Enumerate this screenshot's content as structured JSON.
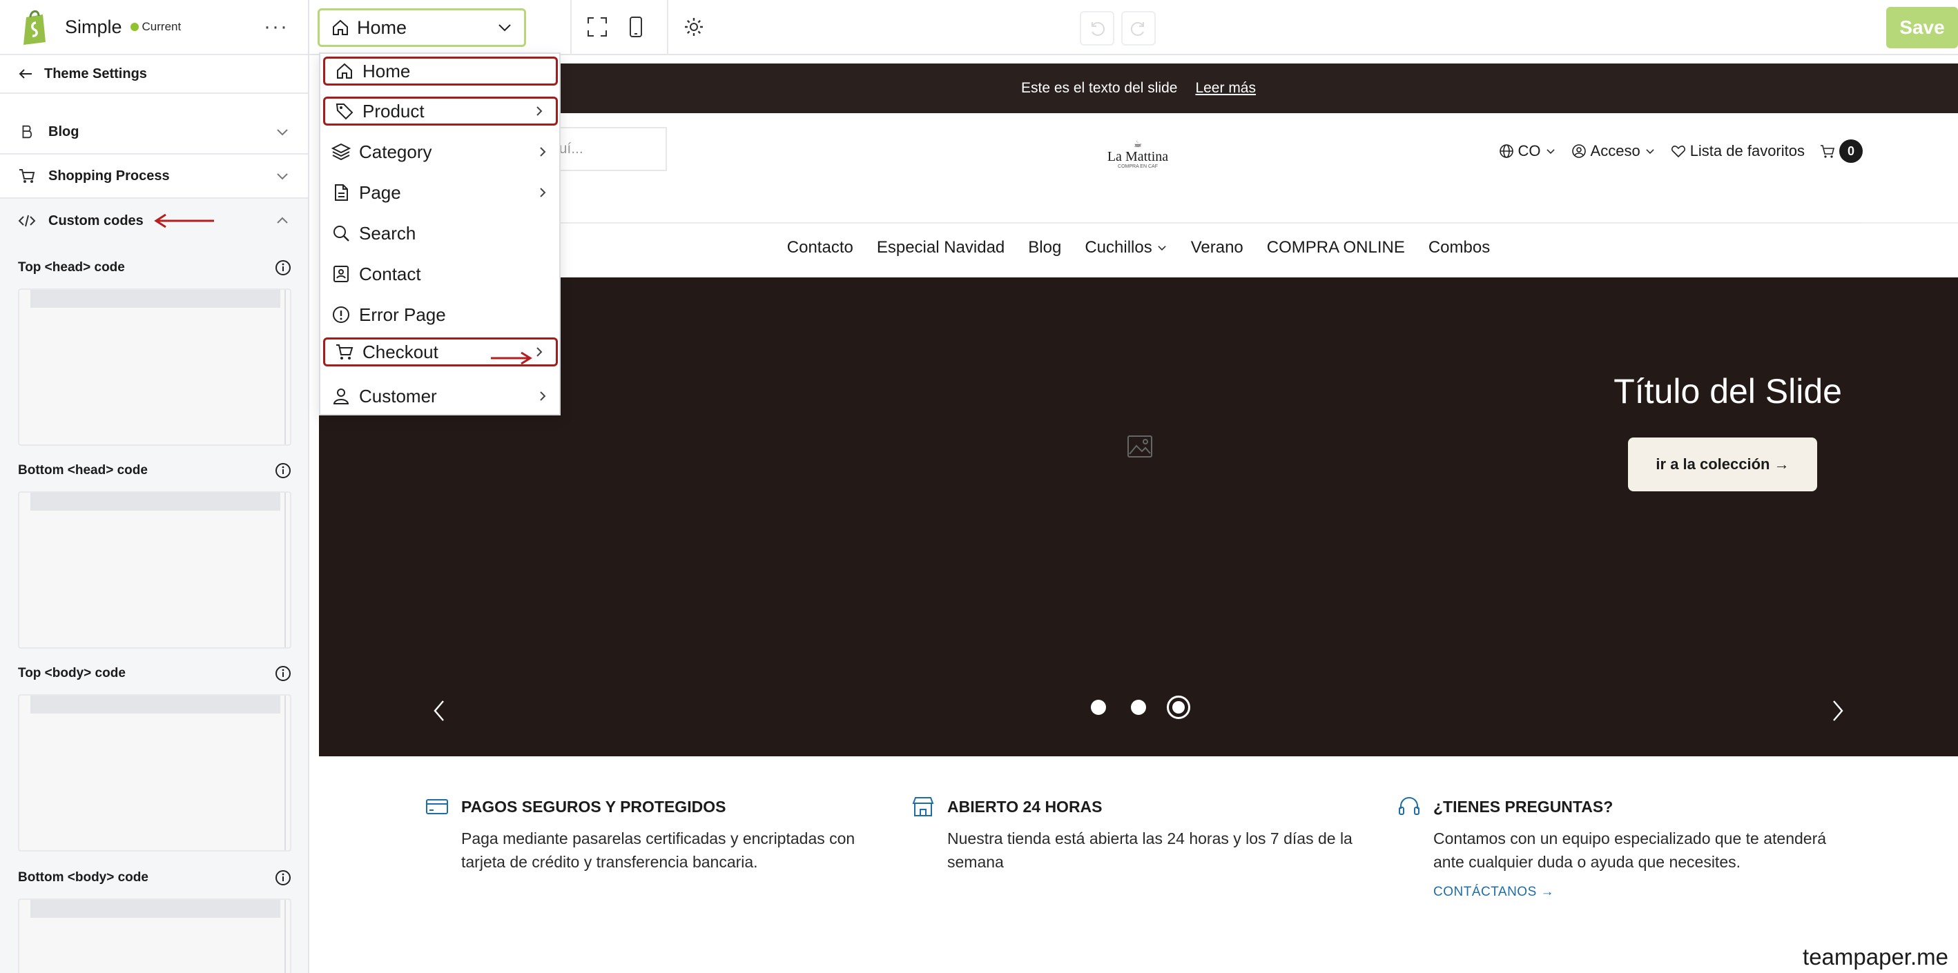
{
  "sidebar": {
    "theme_name": "Simple",
    "current_label": "Current",
    "more": "···",
    "back_label": "Theme Settings",
    "sections": [
      {
        "label": "Blog"
      },
      {
        "label": "Shopping Process"
      },
      {
        "label": "Custom codes"
      }
    ],
    "code_fields": [
      {
        "label": "Top <head> code"
      },
      {
        "label": "Bottom <head> code"
      },
      {
        "label": "Top <body> code"
      },
      {
        "label": "Bottom <body> code"
      }
    ]
  },
  "toolbar": {
    "page_select": "Home",
    "save_label": "Save"
  },
  "dropdown": {
    "items": [
      {
        "label": "Home",
        "icon": "home-icon",
        "has_submenu": false,
        "highlighted": true
      },
      {
        "label": "Product",
        "icon": "tag-icon",
        "has_submenu": true,
        "highlighted": true
      },
      {
        "label": "Category",
        "icon": "layers-icon",
        "has_submenu": true,
        "highlighted": false
      },
      {
        "label": "Page",
        "icon": "file-icon",
        "has_submenu": true,
        "highlighted": false
      },
      {
        "label": "Search",
        "icon": "search-icon",
        "has_submenu": false,
        "highlighted": false
      },
      {
        "label": "Contact",
        "icon": "contact-icon",
        "has_submenu": false,
        "highlighted": false
      },
      {
        "label": "Error Page",
        "icon": "alert-icon",
        "has_submenu": false,
        "highlighted": false
      },
      {
        "label": "Checkout",
        "icon": "cart-icon",
        "has_submenu": true,
        "highlighted": true
      },
      {
        "label": "Customer",
        "icon": "user-icon",
        "has_submenu": true,
        "highlighted": false
      }
    ]
  },
  "preview": {
    "announcement": "Este es el texto del slide",
    "announcement_link": "Leer más",
    "search_placeholder": "ctos aquí...",
    "logo_name": "La Mattina",
    "logo_sub": "COMPRA EN CAF",
    "country": "CO",
    "account": "Acceso",
    "wishlist": "Lista de favoritos",
    "cart_count": "0",
    "menu": [
      "Contacto",
      "Especial Navidad",
      "Blog",
      "Cuchillos",
      "Verano",
      "COMPRA ONLINE",
      "Combos"
    ],
    "hero_title": "Título del Slide",
    "hero_button": "ir a la colección →",
    "slide_count": 3,
    "active_slide": 3,
    "features": [
      {
        "title": "PAGOS SEGUROS Y PROTEGIDOS",
        "body": "Paga mediante pasarelas certificadas y encriptadas con tarjeta de crédito y transferencia bancaria.",
        "link": ""
      },
      {
        "title": "ABIERTO 24 HORAS",
        "body": "Nuestra tienda está abierta las 24 horas y los 7 días de la semana",
        "link": ""
      },
      {
        "title": "¿TIENES PREGUNTAS?",
        "body": "Contamos con un equipo especializado que te atenderá ante cualquier duda o ayuda que necesites.",
        "link": "CONTÁCTANOS →"
      }
    ]
  },
  "watermark": "teampaper.me",
  "colors": {
    "accent": "#b6d878",
    "highlight": "#a31d1d",
    "hero_bg": "#231a17",
    "announce_bg": "#2a201d",
    "link": "#1d6ea8"
  }
}
